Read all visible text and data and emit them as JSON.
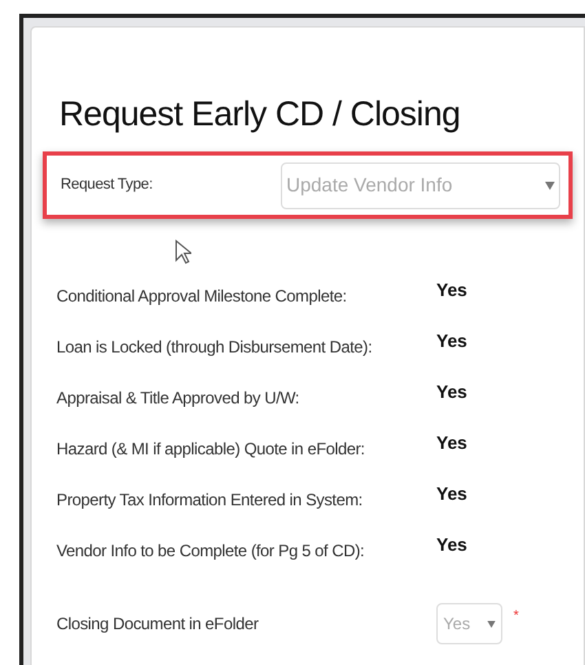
{
  "title": "Request Early CD / Closing",
  "request_type": {
    "label": "Request Type:",
    "value": "Update Vendor Info",
    "highlighted": true
  },
  "checklist": [
    {
      "label": "Conditional Approval Milestone Complete:",
      "value": "Yes"
    },
    {
      "label": "Loan is Locked (through Disbursement Date):",
      "value": "Yes"
    },
    {
      "label": "Appraisal & Title Approved by U/W:",
      "value": "Yes"
    },
    {
      "label": "Hazard (& MI if applicable) Quote in eFolder:",
      "value": "Yes"
    },
    {
      "label": "Property Tax Information Entered in System:",
      "value": "Yes"
    },
    {
      "label": "Vendor Info to be Complete (for Pg 5 of CD):",
      "value": "Yes"
    }
  ],
  "closing_document": {
    "label": "Closing Document in eFolder",
    "value": "Yes",
    "required_mark": "*"
  }
}
